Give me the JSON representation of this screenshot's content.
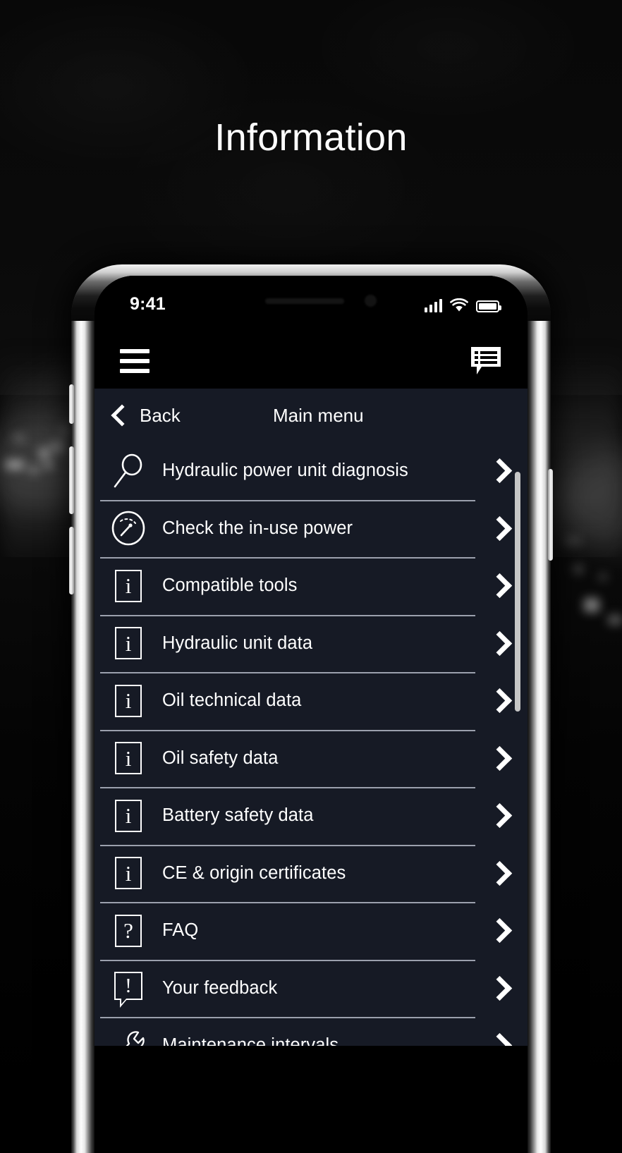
{
  "page": {
    "title": "Information"
  },
  "device": {
    "status_bar": {
      "time": "9:41",
      "signal_icon": "cellular-signal-icon",
      "wifi_icon": "wifi-icon",
      "battery_icon": "battery-full-icon"
    },
    "app_bar": {
      "menu_icon": "hamburger-menu-icon",
      "messages_icon": "message-list-icon"
    }
  },
  "nav": {
    "back_label": "Back",
    "back_icon": "chevron-left-icon",
    "title": "Main menu"
  },
  "menu": {
    "items": [
      {
        "label": "Hydraulic power unit diagnosis",
        "icon": "magnifier-icon",
        "chevron": "chevron-right-icon"
      },
      {
        "label": "Check the in-use power",
        "icon": "gauge-icon",
        "chevron": "chevron-right-icon"
      },
      {
        "label": "Compatible tools",
        "icon": "info-icon",
        "chevron": "chevron-right-icon"
      },
      {
        "label": "Hydraulic unit data",
        "icon": "info-icon",
        "chevron": "chevron-right-icon"
      },
      {
        "label": "Oil technical data",
        "icon": "info-icon",
        "chevron": "chevron-right-icon"
      },
      {
        "label": "Oil safety data",
        "icon": "info-icon",
        "chevron": "chevron-right-icon"
      },
      {
        "label": "Battery safety data",
        "icon": "info-icon",
        "chevron": "chevron-right-icon"
      },
      {
        "label": "CE & origin certificates",
        "icon": "info-icon",
        "chevron": "chevron-right-icon"
      },
      {
        "label": "FAQ",
        "icon": "question-icon",
        "chevron": "chevron-right-icon"
      },
      {
        "label": "Your feedback",
        "icon": "feedback-bubble-icon",
        "chevron": "chevron-right-icon"
      },
      {
        "label": "Maintenance intervals",
        "icon": "wrench-icon",
        "chevron": "chevron-right-icon"
      }
    ],
    "glyphs": {
      "info": "i",
      "question": "?",
      "exclamation": "!"
    }
  },
  "colors": {
    "page_background": "#050505",
    "screen_top_bar": "#000000",
    "list_background": "#161a25",
    "divider": "#9ba0ad",
    "text_primary": "#ffffff",
    "scrollbar_thumb": "#c6c6c6",
    "device_frame": "#fdfdfd"
  }
}
